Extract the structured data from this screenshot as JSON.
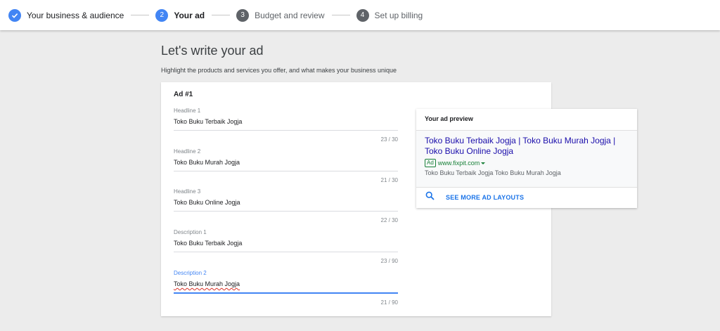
{
  "stepper": {
    "steps": [
      {
        "number": "",
        "label": "Your business & audience",
        "state": "done"
      },
      {
        "number": "2",
        "label": "Your ad",
        "state": "active"
      },
      {
        "number": "3",
        "label": "Budget and review",
        "state": "todo"
      },
      {
        "number": "4",
        "label": "Set up billing",
        "state": "todo"
      }
    ]
  },
  "page": {
    "title": "Let's write your ad",
    "subtitle": "Highlight the products and services you offer, and what makes your business unique"
  },
  "ad": {
    "title": "Ad #1",
    "fields": [
      {
        "label": "Headline 1",
        "value": "Toko Buku Terbaik Jogja",
        "counter": "23 / 30"
      },
      {
        "label": "Headline 2",
        "value": "Toko Buku Murah Jogja",
        "counter": "21 / 30"
      },
      {
        "label": "Headline 3",
        "value": "Toko Buku Online Jogja",
        "counter": "22 / 30"
      },
      {
        "label": "Description 1",
        "value": "Toko Buku Terbaik Jogja",
        "counter": "23 / 90"
      },
      {
        "label": "Description 2",
        "value": "Toko Buku Murah Jogja",
        "counter": "21 / 90"
      }
    ]
  },
  "preview": {
    "title": "Your ad preview",
    "headline": "Toko Buku Terbaik Jogja | Toko Buku Murah Jogja | Toko Buku Online Jogja",
    "badge": "Ad",
    "url": "www.fixpit.com",
    "description": "Toko Buku Terbaik Jogja Toko Buku Murah Jogja",
    "more_label": "SEE MORE AD LAYOUTS"
  },
  "colors": {
    "accent": "#4285f4",
    "link": "#1a0dab",
    "url_green": "#188038"
  }
}
